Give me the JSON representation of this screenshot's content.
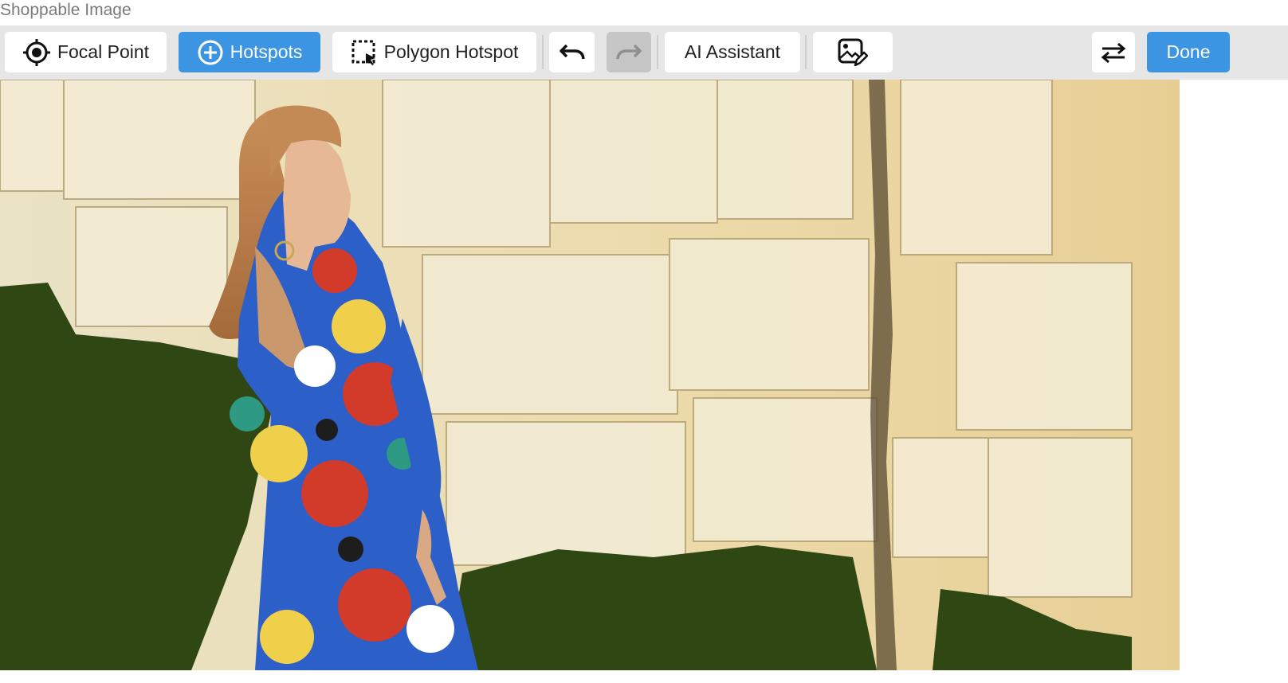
{
  "window": {
    "title": "Shoppable Image"
  },
  "toolbar": {
    "focal_point_label": "Focal Point",
    "hotspots_label": "Hotspots",
    "polygon_hotspot_label": "Polygon Hotspot",
    "ai_assistant_label": "AI Assistant",
    "done_label": "Done",
    "active_tool": "Hotspots"
  },
  "colors": {
    "accent": "#3b95e3",
    "toolbar_bg": "#e6e6e6",
    "disabled_bg": "#c6c6c6"
  },
  "icons": {
    "focal_point": "crosshair-target-icon",
    "hotspots": "plus-circle-icon",
    "polygon_hotspot": "dashed-selection-icon",
    "undo": "undo-arrow-icon",
    "redo": "redo-arrow-icon",
    "image_edit": "image-edit-icon",
    "swap": "swap-arrows-icon"
  },
  "image": {
    "subject": "woman in floral dress against pale limestone wall with green moss",
    "visible_text": ""
  }
}
